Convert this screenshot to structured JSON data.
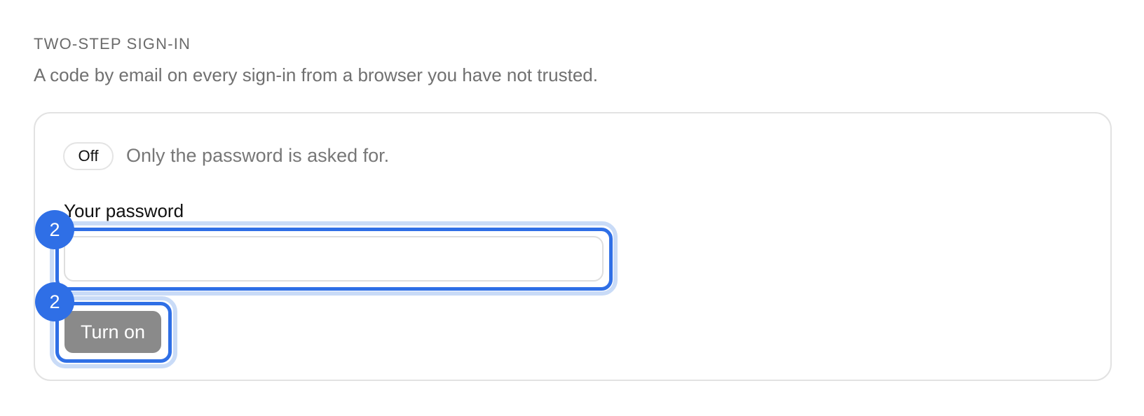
{
  "section": {
    "title": "TWO-STEP SIGN-IN",
    "description": "A code by email on every sign-in from a browser you have not trusted."
  },
  "status": {
    "badge": "Off",
    "text": "Only the password is asked for."
  },
  "password_field": {
    "label": "Your password",
    "value": "",
    "placeholder": ""
  },
  "actions": {
    "turn_on_label": "Turn on"
  },
  "annotations": {
    "input_marker": "2",
    "button_marker": "2"
  },
  "colors": {
    "accent": "#2f6fe6",
    "focus_halo": "#c9dbf7",
    "button_disabled": "#8a8a8a",
    "muted_text": "#707070",
    "border": "#e2e2e2"
  }
}
